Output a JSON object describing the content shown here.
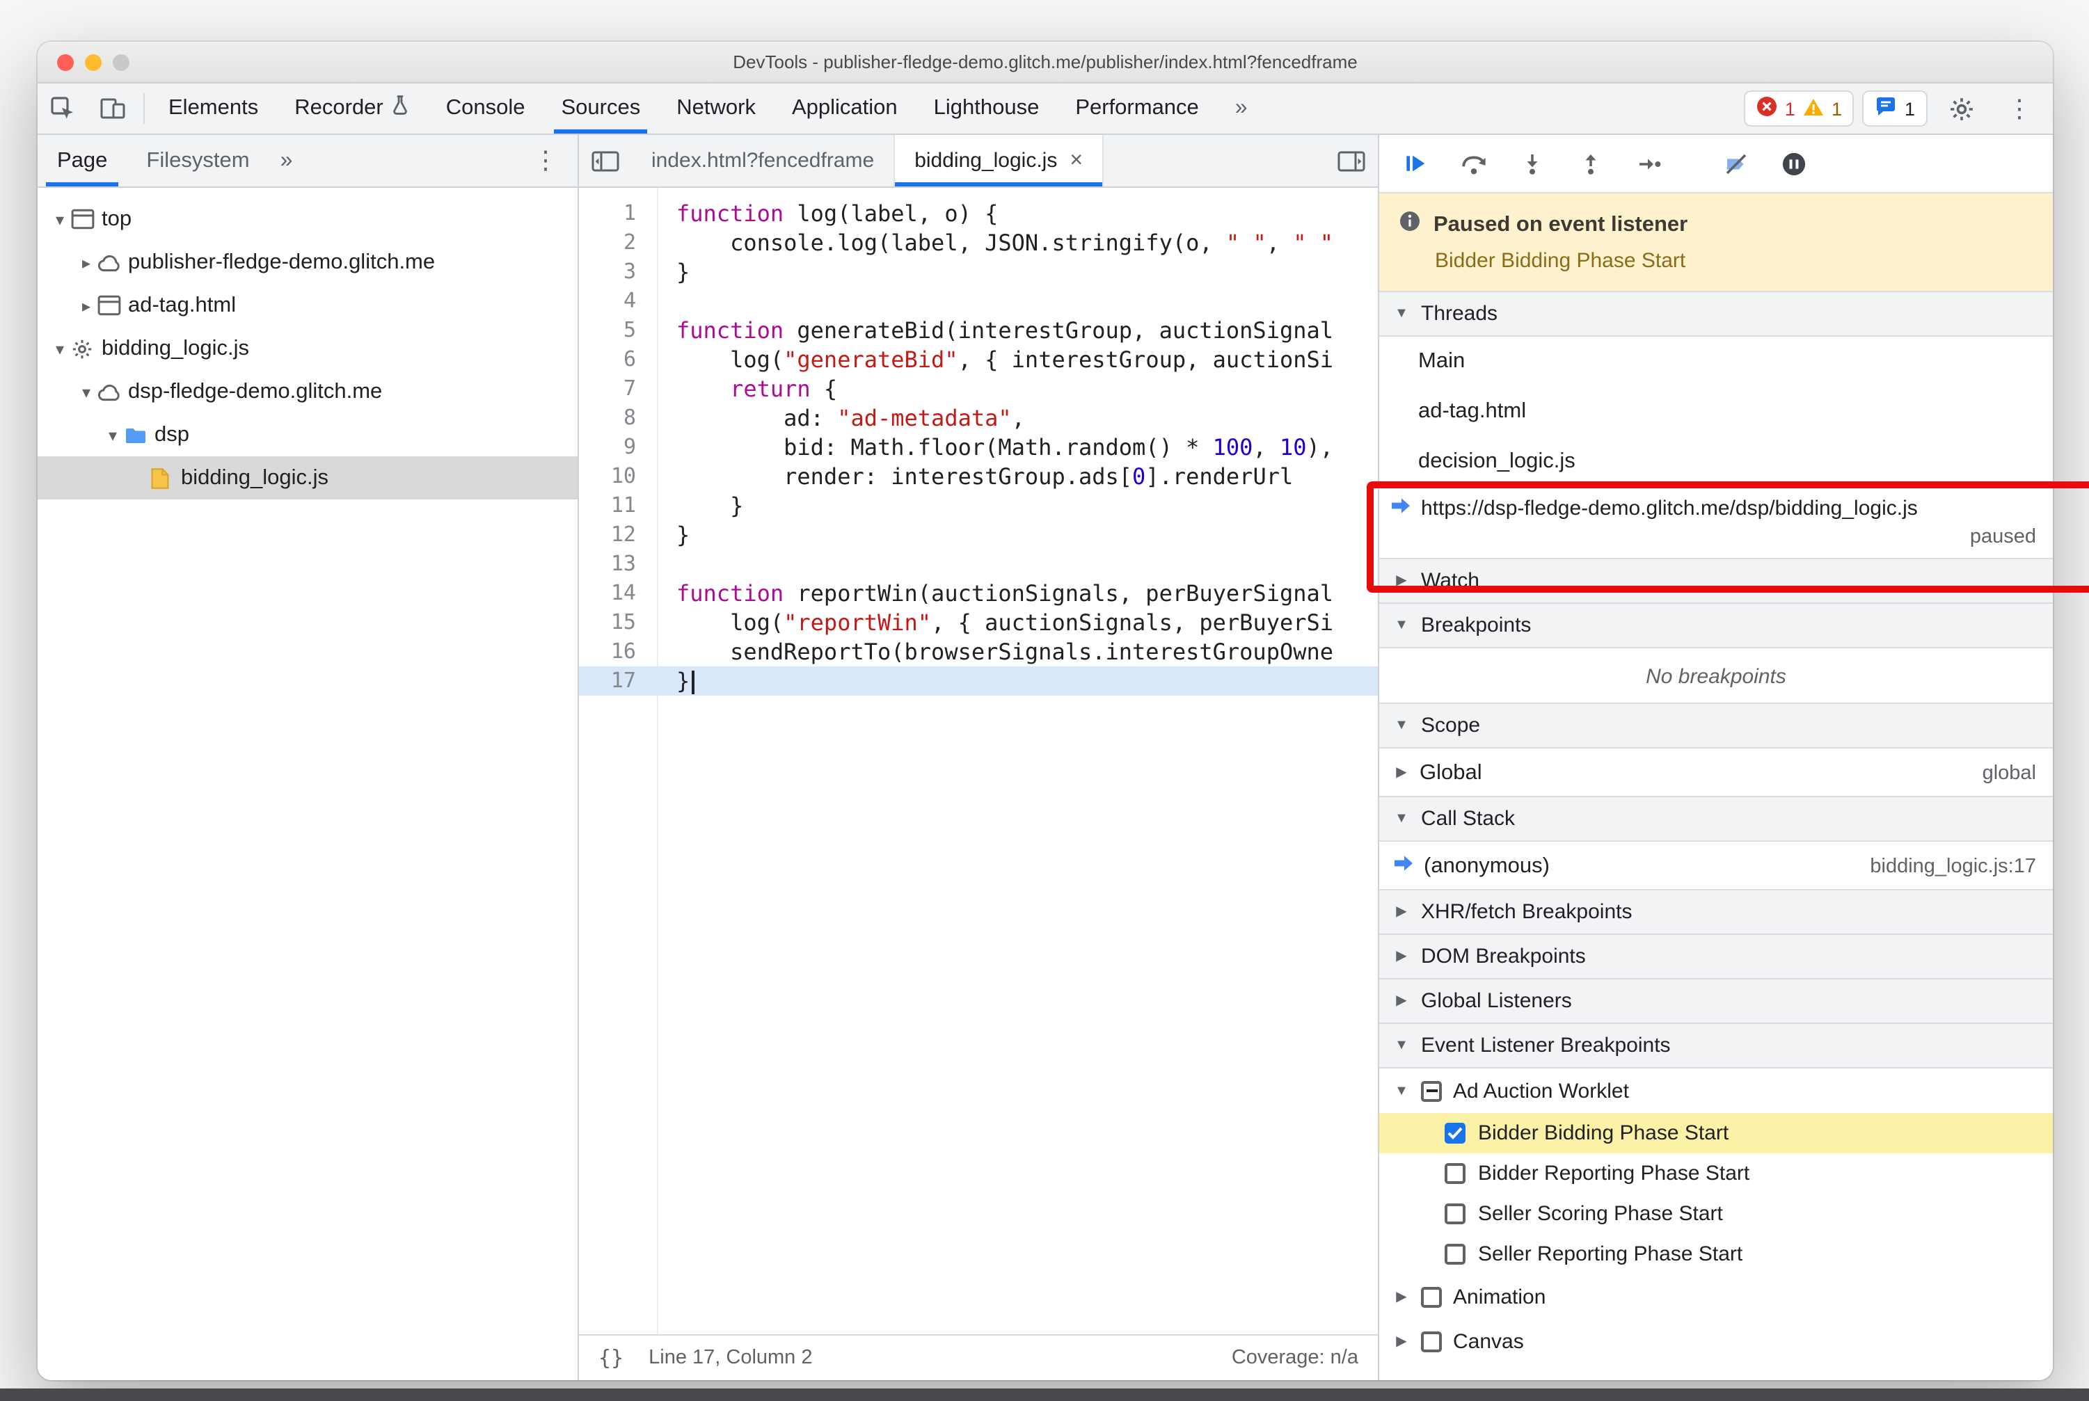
{
  "colors": {
    "accent": "#1a73e8",
    "annotation": "#e80b0b",
    "banner-bg": "#fdf2cd",
    "banner-subtitle": "#8a6d1a",
    "elb-highlight": "#fbf1a7",
    "exec-line": "#d9e7fb"
  },
  "window": {
    "title": "DevTools - publisher-fledge-demo.glitch.me/publisher/index.html?fencedframe"
  },
  "toolbar": {
    "tabs": [
      {
        "label": "Elements"
      },
      {
        "label": "Recorder",
        "flask": true
      },
      {
        "label": "Console"
      },
      {
        "label": "Sources",
        "active": true
      },
      {
        "label": "Network"
      },
      {
        "label": "Application"
      },
      {
        "label": "Lighthouse"
      },
      {
        "label": "Performance"
      }
    ],
    "more": "»",
    "errors": "1",
    "warnings": "1",
    "issues": "1"
  },
  "sidebar": {
    "tabs": [
      {
        "label": "Page",
        "active": true
      },
      {
        "label": "Filesystem"
      }
    ],
    "more": "»",
    "tree": [
      {
        "label": "top",
        "level": 0,
        "icon": "frame",
        "exp": "open"
      },
      {
        "label": "publisher-fledge-demo.glitch.me",
        "level": 1,
        "icon": "cloud",
        "exp": "closed"
      },
      {
        "label": "ad-tag.html",
        "level": 1,
        "icon": "frame",
        "exp": "closed"
      },
      {
        "label": "bidding_logic.js",
        "level": 0,
        "icon": "gear",
        "exp": "open"
      },
      {
        "label": "dsp-fledge-demo.glitch.me",
        "level": 1,
        "icon": "cloud",
        "exp": "open"
      },
      {
        "label": "dsp",
        "level": 2,
        "icon": "folder",
        "exp": "open"
      },
      {
        "label": "bidding_logic.js",
        "level": 3,
        "icon": "js",
        "exp": "none",
        "selected": true
      }
    ]
  },
  "editor": {
    "tabs": [
      {
        "label": "index.html?fencedframe"
      },
      {
        "label": "bidding_logic.js",
        "active": true,
        "close": "×"
      }
    ],
    "current_line": 17,
    "lines": [
      [
        [
          "k",
          "function"
        ],
        [
          "d",
          " log(label, o) {"
        ]
      ],
      [
        [
          "d",
          "    console.log(label, JSON.stringify(o, "
        ],
        [
          "s",
          "\" \""
        ],
        [
          "d",
          ", "
        ],
        [
          "s",
          "\" \""
        ]
      ],
      [
        [
          "d",
          "}"
        ]
      ],
      [],
      [
        [
          "k",
          "function"
        ],
        [
          "d",
          " generateBid(interestGroup, auctionSignal"
        ]
      ],
      [
        [
          "d",
          "    log("
        ],
        [
          "s",
          "\"generateBid\""
        ],
        [
          "d",
          ", { interestGroup, auctionSi"
        ]
      ],
      [
        [
          "d",
          "    "
        ],
        [
          "k",
          "return"
        ],
        [
          "d",
          " {"
        ]
      ],
      [
        [
          "d",
          "        ad: "
        ],
        [
          "s",
          "\"ad-metadata\""
        ],
        [
          "d",
          ","
        ]
      ],
      [
        [
          "d",
          "        bid: Math.floor(Math.random() * "
        ],
        [
          "n",
          "100"
        ],
        [
          "d",
          ", "
        ],
        [
          "n",
          "10"
        ],
        [
          "d",
          "),"
        ]
      ],
      [
        [
          "d",
          "        render: interestGroup.ads["
        ],
        [
          "n",
          "0"
        ],
        [
          "d",
          "].renderUrl"
        ]
      ],
      [
        [
          "d",
          "    }"
        ]
      ],
      [
        [
          "d",
          "}"
        ]
      ],
      [],
      [
        [
          "k",
          "function"
        ],
        [
          "d",
          " reportWin(auctionSignals, perBuyerSignal"
        ]
      ],
      [
        [
          "d",
          "    log("
        ],
        [
          "s",
          "\"reportWin\""
        ],
        [
          "d",
          ", { auctionSignals, perBuyerSi"
        ]
      ],
      [
        [
          "d",
          "    sendReportTo(browserSignals.interestGroupOwne"
        ]
      ],
      [
        [
          "d",
          "}"
        ]
      ]
    ],
    "status": {
      "pretty": "{}",
      "position": "Line 17, Column 2",
      "coverage": "Coverage: n/a"
    }
  },
  "debugger": {
    "banner": {
      "title": "Paused on event listener",
      "subtitle": "Bidder Bidding Phase Start"
    },
    "threads": {
      "title": "Threads",
      "items": [
        {
          "label": "Main"
        },
        {
          "label": "ad-tag.html"
        },
        {
          "label": "decision_logic.js"
        },
        {
          "label": "https://dsp-fledge-demo.glitch.me/dsp/bidding_logic.js",
          "status": "paused",
          "current": true
        }
      ]
    },
    "watch": {
      "title": "Watch"
    },
    "breakpoints": {
      "title": "Breakpoints",
      "empty": "No breakpoints"
    },
    "scope": {
      "title": "Scope",
      "rows": [
        {
          "label": "Global",
          "value": "global"
        }
      ]
    },
    "call_stack": {
      "title": "Call Stack",
      "frames": [
        {
          "label": "(anonymous)",
          "location": "bidding_logic.js:17",
          "current": true
        }
      ]
    },
    "xhr_breakpoints": {
      "title": "XHR/fetch Breakpoints"
    },
    "dom_breakpoints": {
      "title": "DOM Breakpoints"
    },
    "global_listeners": {
      "title": "Global Listeners"
    },
    "event_listener_breakpoints": {
      "title": "Event Listener Breakpoints",
      "groups": [
        {
          "label": "Ad Auction Worklet",
          "checkbox": "indeterminate",
          "exp": "open",
          "children": [
            {
              "label": "Bidder Bidding Phase Start",
              "checkbox": "checked",
              "highlighted": true
            },
            {
              "label": "Bidder Reporting Phase Start",
              "checkbox": "unchecked"
            },
            {
              "label": "Seller Scoring Phase Start",
              "checkbox": "unchecked"
            },
            {
              "label": "Seller Reporting Phase Start",
              "checkbox": "unchecked"
            }
          ]
        },
        {
          "label": "Animation",
          "checkbox": "unchecked",
          "exp": "closed",
          "children": []
        },
        {
          "label": "Canvas",
          "checkbox": "unchecked",
          "exp": "closed",
          "children": []
        }
      ]
    }
  }
}
